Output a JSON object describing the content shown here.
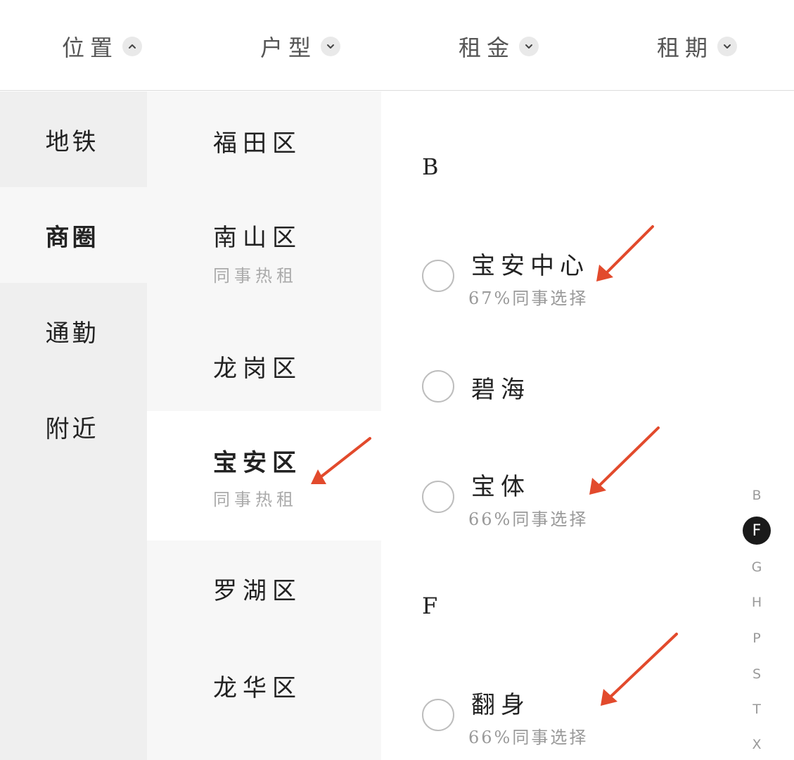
{
  "filters": [
    {
      "label": "位置",
      "chevron": "chevron-up-icon"
    },
    {
      "label": "户型",
      "chevron": "chevron-down-icon"
    },
    {
      "label": "租金",
      "chevron": "chevron-down-icon"
    },
    {
      "label": "租期",
      "chevron": "chevron-down-icon"
    }
  ],
  "location_types": [
    {
      "label": "地铁"
    },
    {
      "label": "商圈",
      "active": true
    },
    {
      "label": "通勤"
    },
    {
      "label": "附近"
    }
  ],
  "districts": [
    {
      "name": "福田区",
      "sub": ""
    },
    {
      "name": "南山区",
      "sub": "同事热租"
    },
    {
      "name": "龙岗区",
      "sub": ""
    },
    {
      "name": "宝安区",
      "sub": "同事热租",
      "active": true
    },
    {
      "name": "罗湖区",
      "sub": ""
    },
    {
      "name": "龙华区",
      "sub": ""
    }
  ],
  "sections": [
    {
      "letter": "B",
      "options": [
        {
          "name": "宝安中心",
          "sub": "67%同事选择"
        },
        {
          "name": "碧海",
          "sub": ""
        },
        {
          "name": "宝体",
          "sub": "66%同事选择"
        }
      ]
    },
    {
      "letter": "F",
      "options": [
        {
          "name": "翻身",
          "sub": "66%同事选择"
        }
      ]
    }
  ],
  "alpha_index": [
    "B",
    "F",
    "G",
    "H",
    "P",
    "S",
    "T",
    "X"
  ],
  "alpha_active": "F",
  "colors": {
    "arrow": "#e24a2c",
    "active_index_bg": "#1a1a1a",
    "radio_border": "#bdbdbd"
  }
}
